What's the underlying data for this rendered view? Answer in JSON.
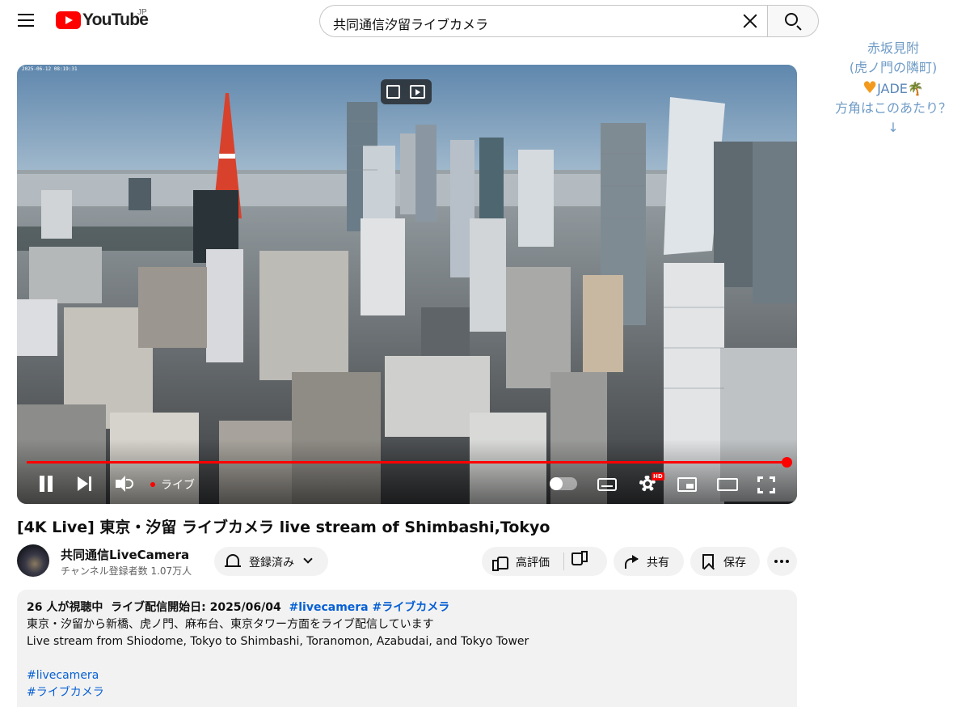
{
  "header": {
    "logo_text": "YouTube",
    "country_code": "JP",
    "search_value": "共同通信汐留ライブカメラ"
  },
  "annotation": {
    "line1": "赤坂見附",
    "line2": "(虎ノ門の隣町)",
    "brand": "JADE",
    "line4": "方角はこのあたり？",
    "arrow": "↓"
  },
  "player": {
    "timestamp": "2025-06-12 08:19:31",
    "live_label": "ライブ",
    "hd_badge": "HD",
    "progress_fraction": 1.0
  },
  "video": {
    "title": "[4K Live] 東京・汐留 ライブカメラ live stream of Shimbashi,Tokyo"
  },
  "channel": {
    "name": "共同通信LiveCamera",
    "subscribers": "チャンネル登録者数 1.07万人",
    "subscribe_label": "登録済み"
  },
  "actions": {
    "like_label": "高評価",
    "share_label": "共有",
    "save_label": "保存"
  },
  "description": {
    "viewers": "26 人が視聴中",
    "started": "ライブ配信開始日: 2025/06/04",
    "tag1": "#livecamera",
    "tag2": "#ライブカメラ",
    "line_ja": "東京・汐留から新橋、虎ノ門、麻布台、東京タワー方面をライブ配信しています",
    "line_en": "Live stream from Shiodome, Tokyo to Shimbashi, Toranomon, Azabudai, and Tokyo Tower",
    "hashtags": [
      "#livecamera",
      "#ライブカメラ"
    ]
  },
  "colors": {
    "youtube_red": "#ff0000",
    "link_blue": "#065fd4",
    "note_blue": "#6f9bc6",
    "heart_orange": "#f39a1c"
  }
}
